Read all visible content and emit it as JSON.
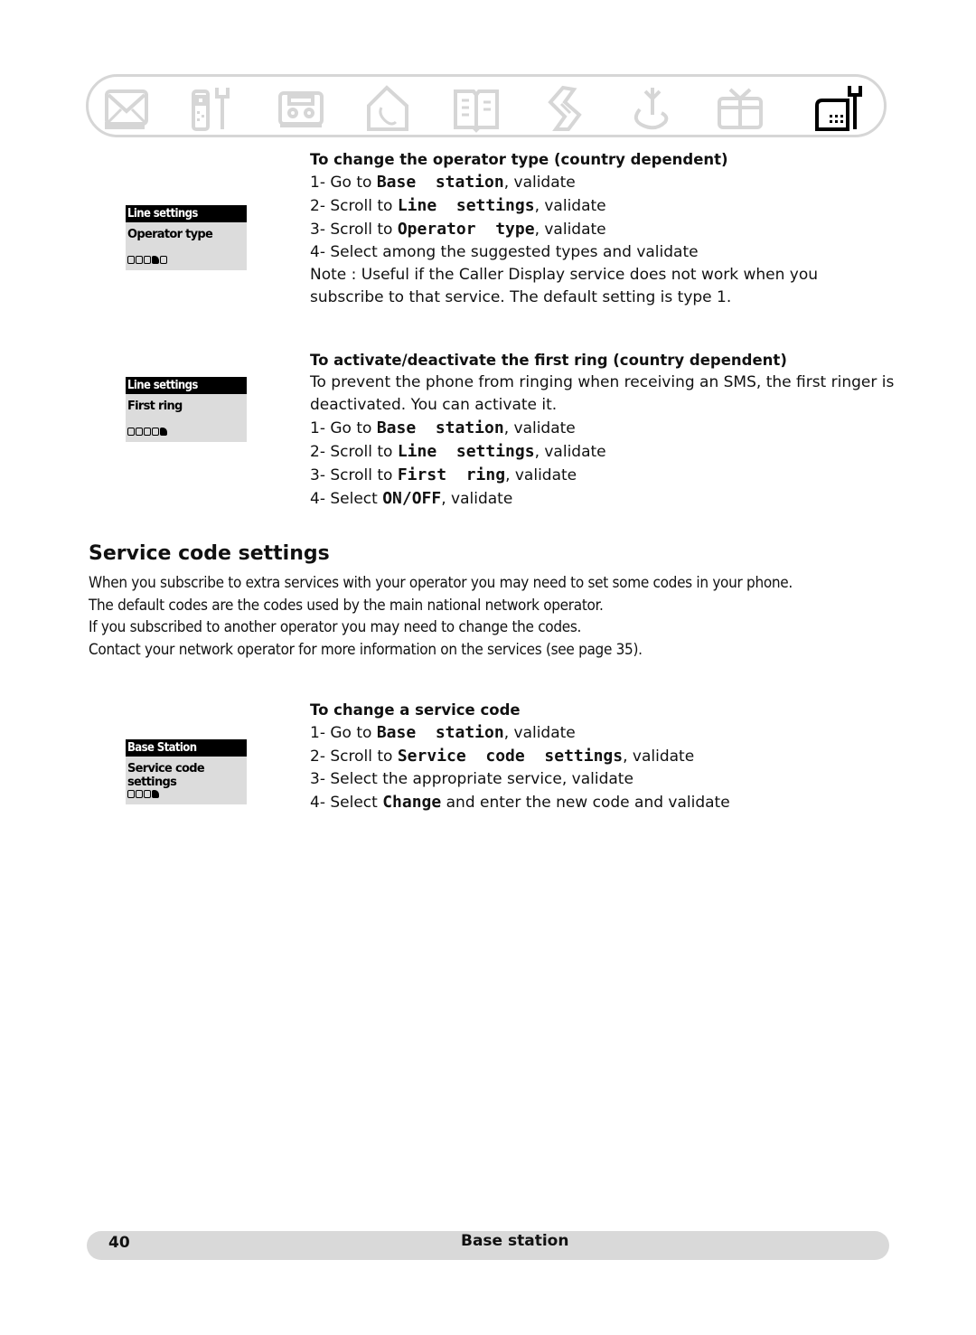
{
  "icon_bar": {
    "icons": [
      {
        "name": "envelope-icon",
        "label": "Messages",
        "active": false
      },
      {
        "name": "handset-tools-icon",
        "label": "Settings",
        "active": false
      },
      {
        "name": "cassette-icon",
        "label": "Answering machine",
        "active": false
      },
      {
        "name": "house-phone-icon",
        "label": "Home",
        "active": false
      },
      {
        "name": "book-icon",
        "label": "Phonebook",
        "active": false
      },
      {
        "name": "scroll-icon",
        "label": "Call log",
        "active": false
      },
      {
        "name": "antenna-icon",
        "label": "Network",
        "active": false
      },
      {
        "name": "gift-icon",
        "label": "Extras",
        "active": false
      },
      {
        "name": "base-station-tools-icon",
        "label": "Base station",
        "active": true
      }
    ],
    "inactive_color": "#d6d6d6",
    "active_color": "#000000"
  },
  "lcd_screens": [
    {
      "title": "Line settings",
      "item": "Operator type",
      "dots": 5,
      "active_dot": 4
    },
    {
      "title": "Line settings",
      "item": "First ring",
      "dots": 5,
      "active_dot": 5
    },
    {
      "title": "Base Station",
      "item": "Service code settings",
      "dots": 4,
      "active_dot": 4
    }
  ],
  "operator_type": {
    "heading": "To change the operator type (country dependent)",
    "steps": [
      {
        "prefix": "1- Go to ",
        "term": "Base  station",
        "suffix": ", validate"
      },
      {
        "prefix": "2- Scroll to ",
        "term": "Line  settings",
        "suffix": ", validate"
      },
      {
        "prefix": "3- Scroll to ",
        "term": "Operator  type",
        "suffix": ", validate"
      },
      {
        "prefix": "4- Select among the suggested types and validate",
        "term": "",
        "suffix": ""
      }
    ],
    "note_line1": "Note : Useful if the Caller Display service does not work when you",
    "note_line2": "subscribe to that service. The default setting is type 1."
  },
  "first_ring": {
    "heading": "To activate/deactivate the first ring (country dependent)",
    "intro_line1": "To prevent the phone from ringing when receiving an SMS, the first ringer is",
    "intro_line2": "deactivated. You can activate it.",
    "steps": [
      {
        "prefix": "1- Go to ",
        "term": "Base  station",
        "suffix": ", validate"
      },
      {
        "prefix": "2- Scroll to ",
        "term": "Line  settings",
        "suffix": ", validate"
      },
      {
        "prefix": "3- Scroll to ",
        "term": "First  ring",
        "suffix": ", validate"
      },
      {
        "prefix": "4- Select ",
        "term": "ON/OFF",
        "suffix": ", validate"
      }
    ]
  },
  "service_code": {
    "title": "Service code settings",
    "paragraphs": [
      "When you subscribe to extra services with your operator you may need to set some codes in your phone.",
      "The default codes are the codes used by the main national network operator.",
      "If you subscribed to another operator you may need to change the codes.",
      "Contact your network operator for more information on the services (see page 35)."
    ],
    "heading": "To change a service code",
    "steps": [
      {
        "prefix": "1- Go to ",
        "term": "Base  station",
        "suffix": ", validate"
      },
      {
        "prefix": "2- Scroll to ",
        "term": "Service  code  settings",
        "suffix": ", validate"
      },
      {
        "prefix": "3- Select the appropriate service, validate",
        "term": "",
        "suffix": ""
      },
      {
        "prefix": "4- Select ",
        "term": "Change",
        "suffix": " and enter the new code and validate"
      }
    ]
  },
  "footer": {
    "page_number": "40",
    "section": "Base station"
  }
}
